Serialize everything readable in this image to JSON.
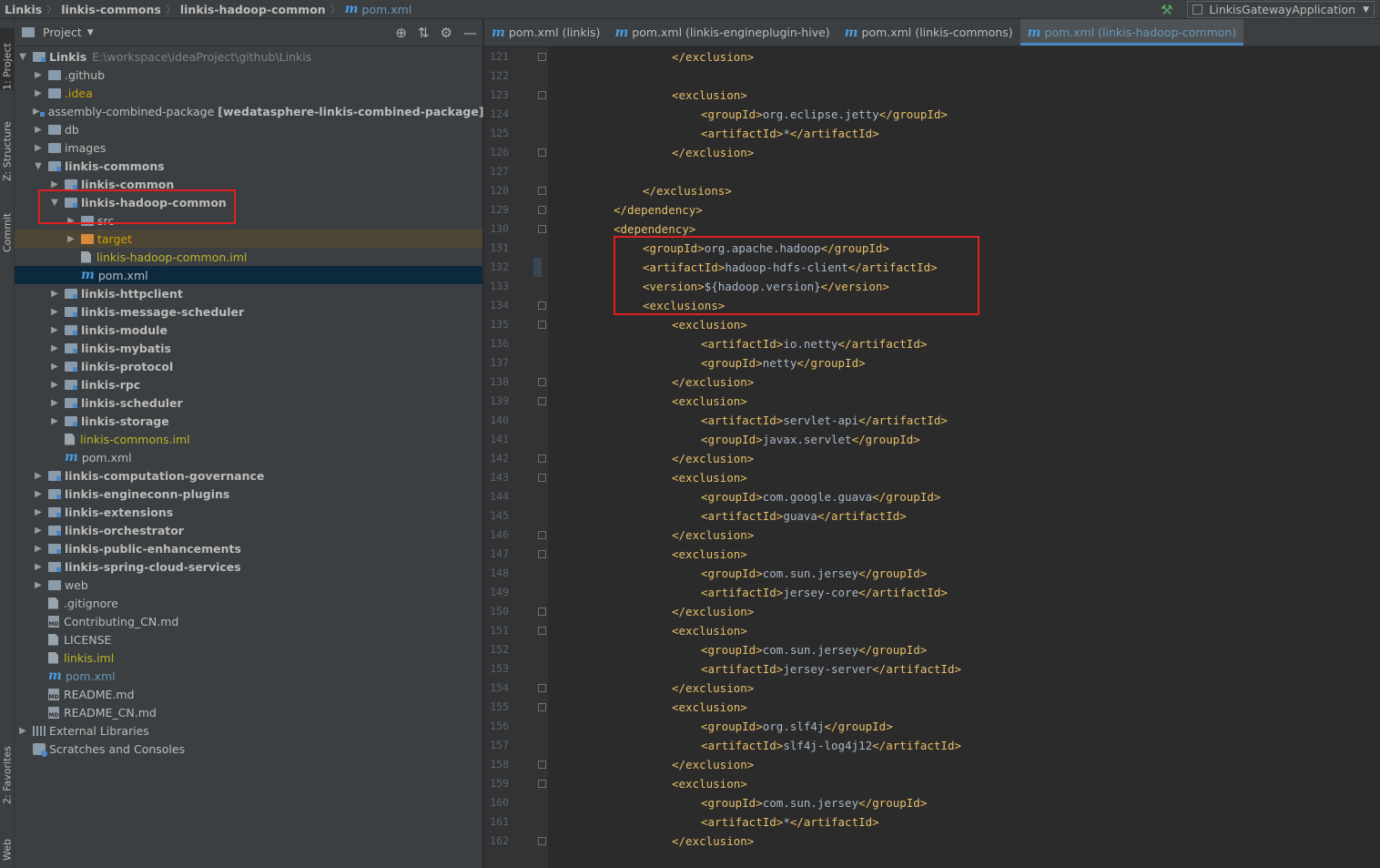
{
  "breadcrumb": [
    "Linkis",
    "linkis-commons",
    "linkis-hadoop-common"
  ],
  "breadcrumb_file": "pom.xml",
  "run_config": "LinkisGatewayApplication",
  "side_tabs": [
    "1: Project",
    "Z: Structure",
    "Commit",
    "2: Favorites",
    "Web"
  ],
  "project": {
    "title": "Project",
    "root": {
      "name": "Linkis",
      "path": "E:\\workspace\\ideaProject\\github\\Linkis"
    },
    "tree": [
      {
        "label": ".github",
        "type": "folder"
      },
      {
        "label": ".idea",
        "type": "folder"
      },
      {
        "label": "assembly-combined-package",
        "detail": "[wedatasphere-linkis-combined-package]",
        "type": "module"
      },
      {
        "label": "db",
        "type": "folder"
      },
      {
        "label": "images",
        "type": "folder"
      },
      {
        "label": "linkis-commons",
        "type": "module"
      },
      {
        "label": "linkis-common",
        "type": "module"
      },
      {
        "label": "linkis-hadoop-common",
        "type": "module"
      },
      {
        "label": "src",
        "type": "folder"
      },
      {
        "label": "target",
        "type": "folder"
      },
      {
        "label": "linkis-hadoop-common.iml",
        "type": "file"
      },
      {
        "label": "pom.xml",
        "type": "pom"
      },
      {
        "label": "linkis-httpclient",
        "type": "module"
      },
      {
        "label": "linkis-message-scheduler",
        "type": "module"
      },
      {
        "label": "linkis-module",
        "type": "module"
      },
      {
        "label": "linkis-mybatis",
        "type": "module"
      },
      {
        "label": "linkis-protocol",
        "type": "module"
      },
      {
        "label": "linkis-rpc",
        "type": "module"
      },
      {
        "label": "linkis-scheduler",
        "type": "module"
      },
      {
        "label": "linkis-storage",
        "type": "module"
      },
      {
        "label": "linkis-commons.iml",
        "type": "file"
      },
      {
        "label": "pom.xml",
        "type": "pom"
      },
      {
        "label": "linkis-computation-governance",
        "type": "module"
      },
      {
        "label": "linkis-engineconn-plugins",
        "type": "module"
      },
      {
        "label": "linkis-extensions",
        "type": "module"
      },
      {
        "label": "linkis-orchestrator",
        "type": "module"
      },
      {
        "label": "linkis-public-enhancements",
        "type": "module"
      },
      {
        "label": "linkis-spring-cloud-services",
        "type": "module"
      },
      {
        "label": "web",
        "type": "folder"
      },
      {
        "label": ".gitignore",
        "type": "file"
      },
      {
        "label": "Contributing_CN.md",
        "type": "md"
      },
      {
        "label": "LICENSE",
        "type": "file"
      },
      {
        "label": "linkis.iml",
        "type": "file"
      },
      {
        "label": "pom.xml",
        "type": "pom"
      },
      {
        "label": "README.md",
        "type": "md"
      },
      {
        "label": "README_CN.md",
        "type": "md"
      },
      {
        "label": "External Libraries",
        "type": "lib"
      },
      {
        "label": "Scratches and Consoles",
        "type": "scratch"
      }
    ]
  },
  "tabs": [
    "pom.xml (linkis)",
    "pom.xml (linkis-engineplugin-hive)",
    "pom.xml (linkis-commons)",
    "pom.xml (linkis-hadoop-common)"
  ],
  "code": [
    {
      "n": "121",
      "open": "</exclusion>",
      "text": "",
      "close": ""
    },
    {
      "n": "122",
      "open": "",
      "text": "",
      "close": ""
    },
    {
      "n": "123",
      "open": "<exclusion>",
      "text": "",
      "close": ""
    },
    {
      "n": "124",
      "open": "<groupId>",
      "text": "org.eclipse.jetty",
      "close": "</groupId>"
    },
    {
      "n": "125",
      "open": "<artifactId>",
      "text": "*",
      "close": "</artifactId>"
    },
    {
      "n": "126",
      "open": "</exclusion>",
      "text": "",
      "close": ""
    },
    {
      "n": "127",
      "open": "",
      "text": "",
      "close": ""
    },
    {
      "n": "128",
      "open": "</exclusions>",
      "text": "",
      "close": ""
    },
    {
      "n": "129",
      "open": "</dependency>",
      "text": "",
      "close": ""
    },
    {
      "n": "130",
      "open": "<dependency>",
      "text": "",
      "close": ""
    },
    {
      "n": "131",
      "open": "<groupId>",
      "text": "org.apache.hadoop",
      "close": "</groupId>"
    },
    {
      "n": "132",
      "open": "<artifactId>",
      "text": "hadoop-hdfs-client",
      "close": "</artifactId>"
    },
    {
      "n": "133",
      "open": "<version>",
      "text": "${hadoop.version}",
      "close": "</version>"
    },
    {
      "n": "134",
      "open": "<exclusions>",
      "text": "",
      "close": ""
    },
    {
      "n": "135",
      "open": "<exclusion>",
      "text": "",
      "close": ""
    },
    {
      "n": "136",
      "open": "<artifactId>",
      "text": "io.netty",
      "close": "</artifactId>"
    },
    {
      "n": "137",
      "open": "<groupId>",
      "text": "netty",
      "close": "</groupId>"
    },
    {
      "n": "138",
      "open": "</exclusion>",
      "text": "",
      "close": ""
    },
    {
      "n": "139",
      "open": "<exclusion>",
      "text": "",
      "close": ""
    },
    {
      "n": "140",
      "open": "<artifactId>",
      "text": "servlet-api",
      "close": "</artifactId>"
    },
    {
      "n": "141",
      "open": "<groupId>",
      "text": "javax.servlet",
      "close": "</groupId>"
    },
    {
      "n": "142",
      "open": "</exclusion>",
      "text": "",
      "close": ""
    },
    {
      "n": "143",
      "open": "<exclusion>",
      "text": "",
      "close": ""
    },
    {
      "n": "144",
      "open": "<groupId>",
      "text": "com.google.guava",
      "close": "</groupId>"
    },
    {
      "n": "145",
      "open": "<artifactId>",
      "text": "guava",
      "close": "</artifactId>"
    },
    {
      "n": "146",
      "open": "</exclusion>",
      "text": "",
      "close": ""
    },
    {
      "n": "147",
      "open": "<exclusion>",
      "text": "",
      "close": ""
    },
    {
      "n": "148",
      "open": "<groupId>",
      "text": "com.sun.jersey",
      "close": "</groupId>"
    },
    {
      "n": "149",
      "open": "<artifactId>",
      "text": "jersey-core",
      "close": "</artifactId>"
    },
    {
      "n": "150",
      "open": "</exclusion>",
      "text": "",
      "close": ""
    },
    {
      "n": "151",
      "open": "<exclusion>",
      "text": "",
      "close": ""
    },
    {
      "n": "152",
      "open": "<groupId>",
      "text": "com.sun.jersey",
      "close": "</groupId>"
    },
    {
      "n": "153",
      "open": "<artifactId>",
      "text": "jersey-server",
      "close": "</artifactId>"
    },
    {
      "n": "154",
      "open": "</exclusion>",
      "text": "",
      "close": ""
    },
    {
      "n": "155",
      "open": "<exclusion>",
      "text": "",
      "close": ""
    },
    {
      "n": "156",
      "open": "<groupId>",
      "text": "org.slf4j",
      "close": "</groupId>"
    },
    {
      "n": "157",
      "open": "<artifactId>",
      "text": "slf4j-log4j12",
      "close": "</artifactId>"
    },
    {
      "n": "158",
      "open": "</exclusion>",
      "text": "",
      "close": ""
    },
    {
      "n": "159",
      "open": "<exclusion>",
      "text": "",
      "close": ""
    },
    {
      "n": "160",
      "open": "<groupId>",
      "text": "com.sun.jersey",
      "close": "</groupId>"
    },
    {
      "n": "161",
      "open": "<artifactId>",
      "text": "*",
      "close": "</artifactId>"
    },
    {
      "n": "162",
      "open": "</exclusion>",
      "text": "",
      "close": ""
    }
  ]
}
